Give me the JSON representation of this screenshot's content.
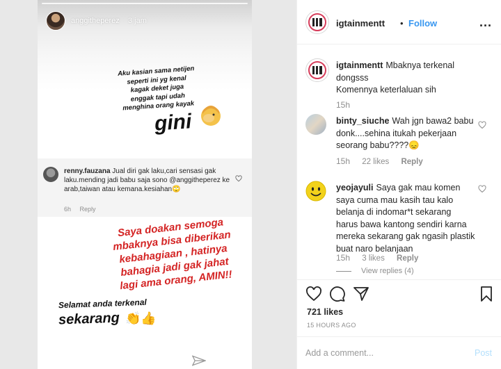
{
  "story": {
    "username": "anggitheperez",
    "time": "3 jam",
    "caption_lines": [
      "Aku kasian sama netijen",
      "seperti ini yg kenal",
      "kagak deket juga",
      "enggak tapi udah",
      "menghina orang kayak"
    ],
    "gini": "gini",
    "comment": {
      "username": "renny.fauzana",
      "text": "Jual diri gak laku,cari sensasi gak laku.mending jadi babu saja sono @anggitheperez ke arab,taiwan atau kemana.kesiahan🙄",
      "time": "6h",
      "reply": "Reply"
    },
    "prayer_lines": [
      "Saya doakan semoga",
      "mbaknya bisa diberikan",
      "kebahagiaan , hatinya",
      "bahagia jadi gak jahat",
      "lagi ama orang, AMIN!!"
    ],
    "closing_small": "Selamat anda terkenal",
    "closing_big": "sekarang",
    "closing_emoji": "👏👍"
  },
  "header": {
    "username": "igtainmentt",
    "separator": "•",
    "follow": "Follow",
    "more": "..."
  },
  "comments": [
    {
      "username": "igtainmentt",
      "text": "Mbaknya terkenal dongsss\nKomennya keterlaluan sih",
      "time": "15h"
    },
    {
      "username": "binty_siuche",
      "text": "Wah jgn bawa2 babu donk....sehina itukah pekerjaan seorang babu????😞",
      "time": "15h",
      "likes": "22 likes",
      "reply": "Reply"
    },
    {
      "username": "yeojayuli",
      "text": "Saya gak mau komen saya cuma mau kasih tau kalo belanja di indomar*t sekarang harus bawa kantong sendiri karna mereka sekarang gak ngasih plastik buat naro belanjaan",
      "time": "15h",
      "likes": "3 likes",
      "reply": "Reply",
      "view_replies": "View replies (4)"
    }
  ],
  "post": {
    "likes": "721 likes",
    "time_ago": "15 HOURS AGO",
    "add_comment_placeholder": "Add a comment...",
    "post_label": "Post"
  },
  "icons": [
    "heart-icon",
    "comment-icon",
    "share-icon",
    "bookmark-icon",
    "more-icon",
    "send-icon"
  ],
  "colors": {
    "follow": "#3897f0",
    "post_disabled": "#b2dffc",
    "prayer_text": "#d42424",
    "muted": "#8e8e8e"
  }
}
